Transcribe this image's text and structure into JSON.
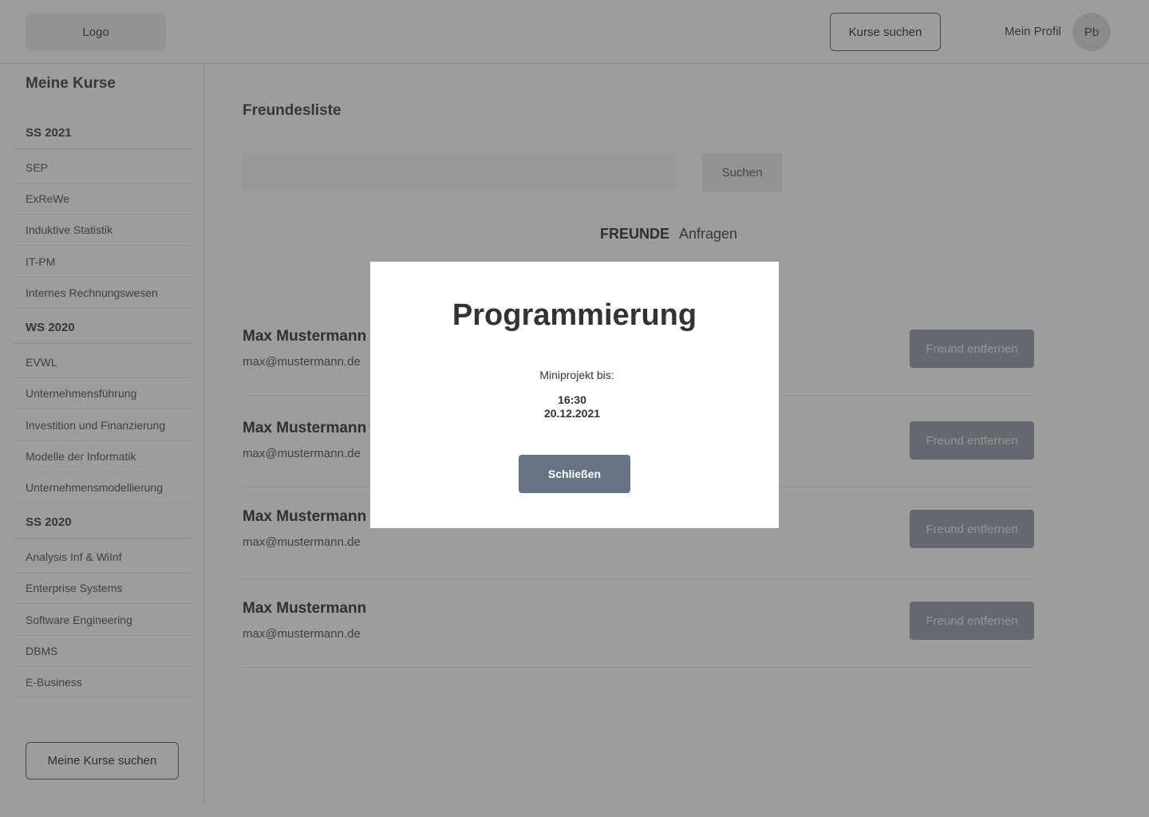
{
  "header": {
    "logo": "Logo",
    "search_courses": "Kurse suchen",
    "profile_label": "Mein Profil",
    "avatar_initials": "Pb"
  },
  "sidebar": {
    "title": "Meine Kurse",
    "semesters": [
      {
        "name": "SS 2021",
        "courses": [
          "SEP",
          "ExReWe",
          "Induktive Statistik",
          "IT-PM",
          "Internes Rechnungswesen"
        ]
      },
      {
        "name": "WS 2020",
        "courses": [
          "EVWL",
          "Unternehmensführung",
          "Investition und Finanzierung",
          "Modelle der Informatik",
          "Unternehmensmodellierung"
        ]
      },
      {
        "name": "SS 2020",
        "courses": [
          "Analysis Inf & WiInf",
          "Enterprise Systems",
          "Software Engineering",
          "DBMS",
          "E-Business"
        ]
      }
    ],
    "search_button": "Meine Kurse suchen"
  },
  "main": {
    "title": "Freundesliste",
    "search_value": "",
    "search_button": "Suchen",
    "tabs": [
      "FREUNDE",
      "Anfragen"
    ],
    "friends": [
      {
        "name": "Max Mustermann",
        "email": "max@mustermann.de",
        "action": "Freund entfernen"
      },
      {
        "name": "Max Mustermann",
        "email": "max@mustermann.de",
        "action": "Freund entfernen"
      },
      {
        "name": "Max Mustermann",
        "email": "max@mustermann.de",
        "action": "Freund entfernen"
      },
      {
        "name": "Max Mustermann",
        "email": "max@mustermann.de",
        "action": "Freund entfernen"
      }
    ]
  },
  "modal": {
    "title": "Programmierung",
    "subtitle": "Miniprojekt bis:",
    "time": "16:30",
    "date": "20.12.2021",
    "close_button": "Schließen"
  },
  "colors": {
    "overlay": "#3c3c3c",
    "primary_button": "#657382",
    "secondary_button": "#8b97a3"
  }
}
